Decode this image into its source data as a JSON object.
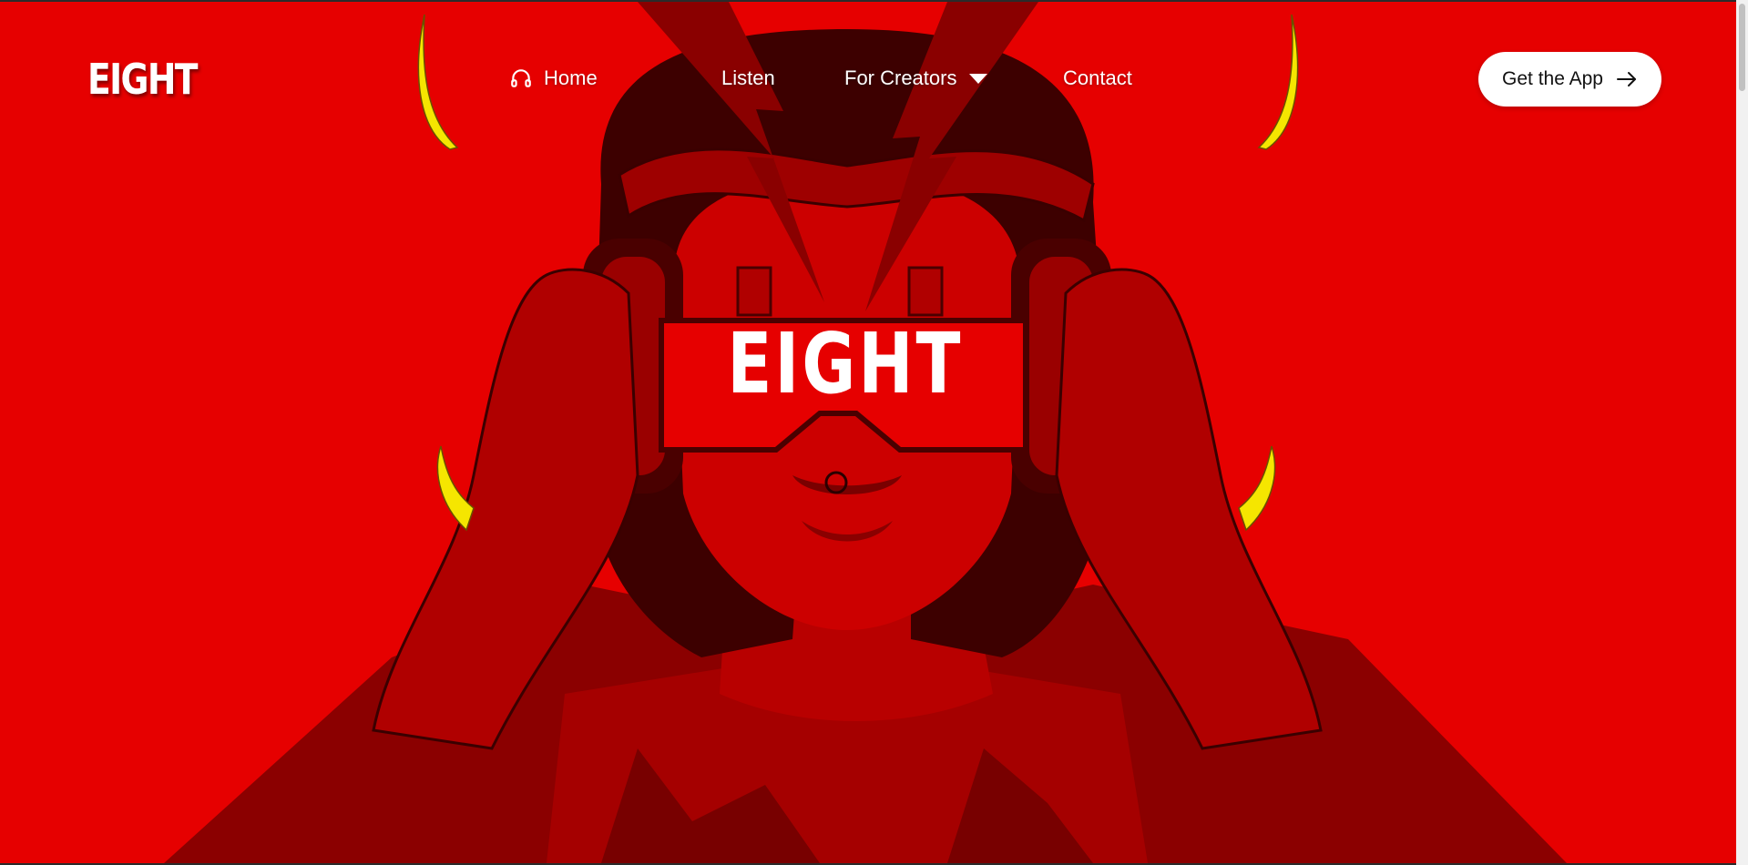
{
  "brand": {
    "logo_text": "EIGHT",
    "visor_text": "EIGHT",
    "accent": "#e60000",
    "highlight": "#f5e600"
  },
  "nav": {
    "items": [
      {
        "label": "Home",
        "icon": "headphones-icon"
      },
      {
        "label": "Listen"
      },
      {
        "label": "For Creators",
        "icon": "caret-down-icon"
      },
      {
        "label": "Contact"
      }
    ]
  },
  "cta": {
    "label": "Get the App",
    "icon": "arrow-right-icon"
  }
}
